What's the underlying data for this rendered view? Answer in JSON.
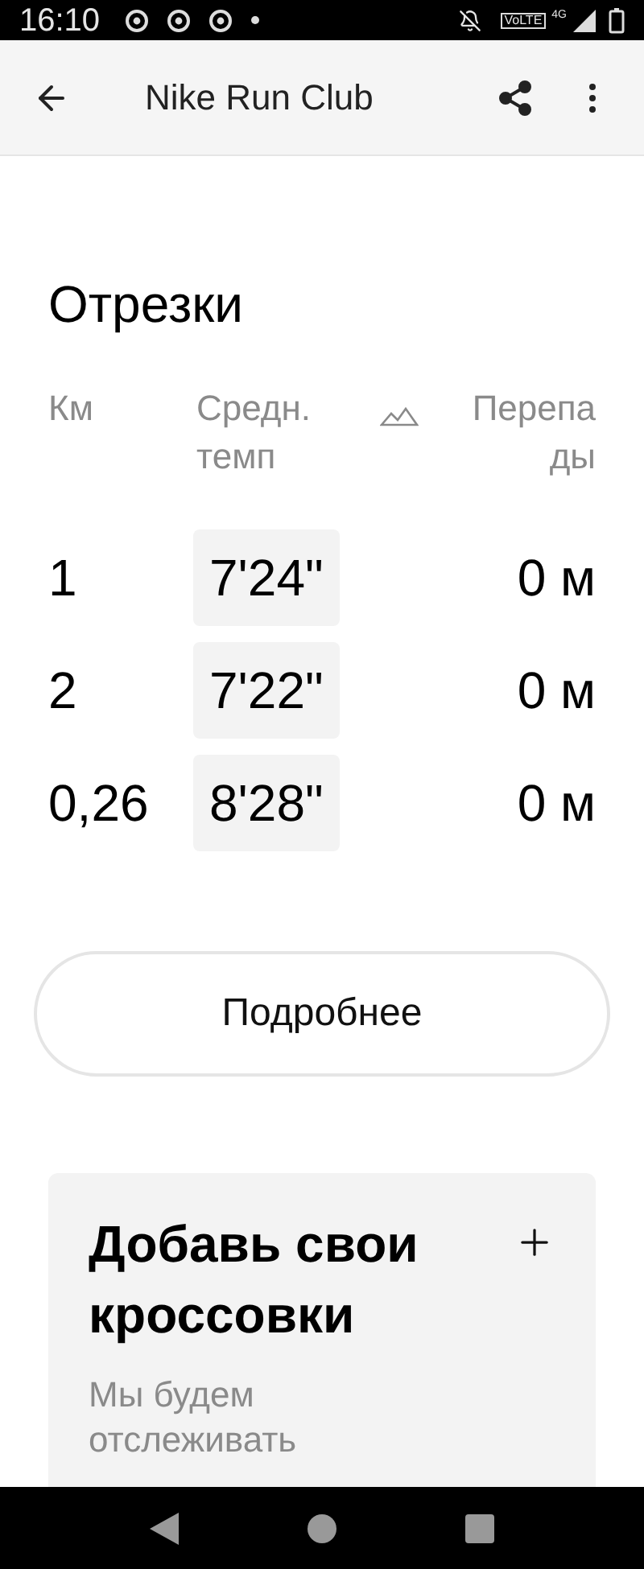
{
  "status_bar": {
    "time": "16:10",
    "volte": "VoLTE",
    "network": "4G"
  },
  "app_bar": {
    "title": "Nike Run Club"
  },
  "splits": {
    "title": "Отрезки",
    "columns": [
      "Км",
      "Средн. темп",
      "Перепа ды"
    ],
    "rows": [
      {
        "km": "1",
        "pace": "7'24\"",
        "elevation": "0 м"
      },
      {
        "km": "2",
        "pace": "7'22\"",
        "elevation": "0 м"
      },
      {
        "km": "0,26",
        "pace": "8'28\"",
        "elevation": "0 м"
      }
    ]
  },
  "details_button": "Подробнее",
  "shoes_card": {
    "title": "Добавь свои кроссовки",
    "text": "Мы будем отслеживать"
  }
}
